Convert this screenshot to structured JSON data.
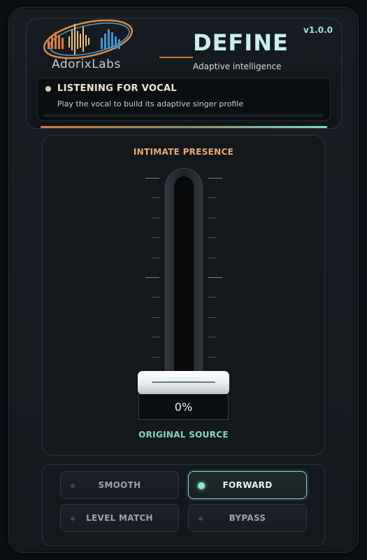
{
  "header": {
    "logo_text": "AdorixLabs",
    "title": "DEFINE",
    "subtitle": "Adaptive intelligence",
    "version": "v1.0.0"
  },
  "status": {
    "title": "LISTENING FOR VOCAL",
    "message": "Play the vocal to build its adaptive singer profile",
    "progress": 0
  },
  "fader": {
    "top_label": "INTIMATE PRESENCE",
    "bottom_label": "ORIGINAL SOURCE",
    "value": 0,
    "value_text": "0%"
  },
  "modes": [
    {
      "label": "SMOOTH",
      "active": false
    },
    {
      "label": "FORWARD",
      "active": true
    },
    {
      "label": "LEVEL MATCH",
      "active": false
    },
    {
      "label": "BYPASS",
      "active": false
    }
  ],
  "colors": {
    "accent_teal": "#7fd8c8",
    "accent_orange": "#d2793b",
    "top_label": "#f0a870",
    "bottom_label": "#86d8c6"
  }
}
